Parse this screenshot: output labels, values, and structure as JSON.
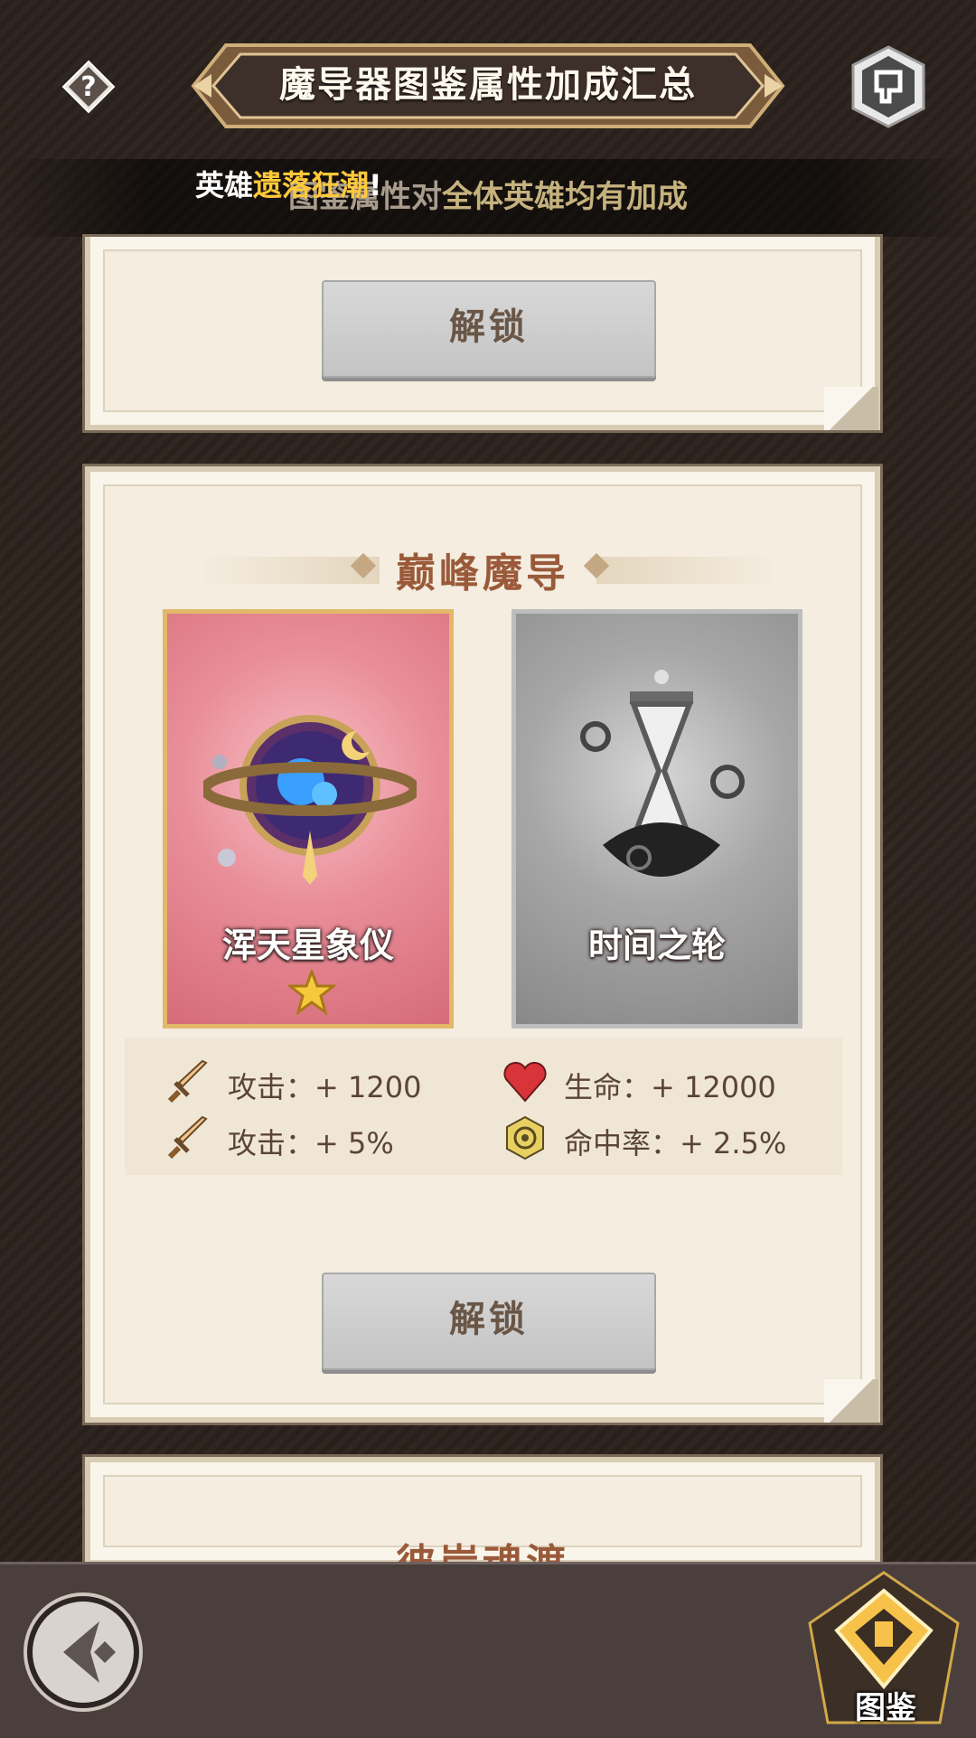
{
  "header": {
    "title": "魔导器图鉴属性加成汇总",
    "help_icon": "question-icon",
    "corner_icon": "shield-emblem-icon"
  },
  "ticker": {
    "subtitle_a": "图鉴属性",
    "subtitle_b": "对",
    "subtitle_c": "全体英雄均有加成",
    "overlay_prefix": "英雄",
    "overlay_highlight": "遗落狂潮",
    "overlay_suffix": "!"
  },
  "card1": {
    "unlock_label": "解锁"
  },
  "card2": {
    "section_title": "巅峰魔导",
    "items": [
      {
        "name": "浑天星象仪",
        "stars": 1,
        "state": "owned"
      },
      {
        "name": "时间之轮",
        "stars": 0,
        "state": "locked"
      }
    ],
    "stats": [
      {
        "icon": "sword-icon",
        "label": "攻击：+ 1200"
      },
      {
        "icon": "heart-icon",
        "label": "生命：+ 12000"
      },
      {
        "icon": "sword-icon",
        "label": "攻击：+ 5%"
      },
      {
        "icon": "target-icon",
        "label": "命中率：+ 2.5%"
      }
    ],
    "unlock_label": "解锁"
  },
  "card3": {
    "section_title": "彼岸魂渡"
  },
  "bottom": {
    "back_icon": "back-arrow-icon",
    "codex_label": "图鉴"
  },
  "colors": {
    "background": "#2a211c",
    "card_bg": "#f4ede0",
    "section_title": "#9a5a3a",
    "gold_highlight": "#ffc93a",
    "pink_card": "#e98e99",
    "grey_card": "#a7a7a7"
  }
}
